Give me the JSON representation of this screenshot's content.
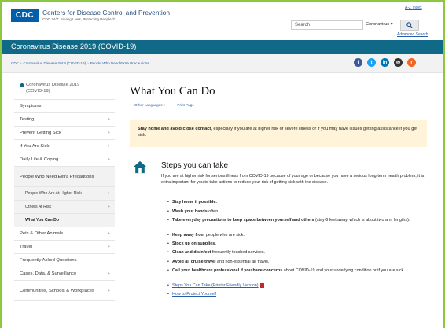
{
  "header": {
    "logo_text": "CDC",
    "brand_name": "Centers for Disease Control and Prevention",
    "brand_tagline": "CDC 24/7: Saving Lives, Protecting People™",
    "az_link": "A-Z Index",
    "search_placeholder": "Search",
    "search_scope": "Coronavirus ▾",
    "advanced_search": "Advanced Search"
  },
  "titlebar": {
    "title": "Coronavirus Disease 2019 (COVID-19)"
  },
  "breadcrumb": [
    "CDC",
    "Coronavirus Disease 2019 (COVID-19)",
    "People Who Need Extra Precautions"
  ],
  "social": [
    {
      "name": "facebook-icon",
      "glyph": "f",
      "color": "#3b5998"
    },
    {
      "name": "twitter-icon",
      "glyph": "t",
      "color": "#1da1f2"
    },
    {
      "name": "linkedin-icon",
      "glyph": "in",
      "color": "#0077b5"
    },
    {
      "name": "email-icon",
      "glyph": "✉",
      "color": "#333333"
    },
    {
      "name": "rss-icon",
      "glyph": "r",
      "color": "#f26522"
    }
  ],
  "sidebar": {
    "items": [
      {
        "label": "Coronavirus Disease 2019 (COVID-19)",
        "home": true
      },
      {
        "label": "Symptoms"
      },
      {
        "label": "Testing",
        "chevron": true
      },
      {
        "label": "Prevent Getting Sick",
        "chevron": true
      },
      {
        "label": "If You Are Sick",
        "chevron": true
      },
      {
        "label": "Daily Life & Coping",
        "chevron": true
      },
      {
        "label": "People Who Need Extra Precautions",
        "selected": true
      },
      {
        "label": "People Who Are At Higher Risk",
        "sub": true,
        "chevron": true
      },
      {
        "label": "Others At Risk",
        "sub": true,
        "chevron": true
      },
      {
        "label": "What You Can Do",
        "sub": true,
        "current": true
      },
      {
        "label": "Pets & Other Animals",
        "chevron": true
      },
      {
        "label": "Travel",
        "chevron": true
      },
      {
        "label": "Frequently Asked Questions"
      },
      {
        "label": "Cases, Data, & Surveillance",
        "chevron": true
      },
      {
        "label": "Communities, Schools & Workplaces",
        "chevron": true
      }
    ]
  },
  "main": {
    "title": "What You Can Do",
    "other_languages": "Other Languages ▾",
    "print_page": "Print Page",
    "alert_bold": "Stay home and avoid close contact,",
    "alert_text": " especially if you are at higher risk of severe illness or if you may have issues getting assistance if you get sick.",
    "steps_heading": "Steps you can take",
    "steps_intro": "If you are at higher risk for serious illness from COVID-19 because of your age or because you have a serious long-term health problem, it is extra important for you to take actions to reduce your risk of getting sick with the disease.",
    "bullets": [
      {
        "bold": "Stay home if possible.",
        "text": ""
      },
      {
        "bold": "Wash your hands",
        "text": " often."
      },
      {
        "bold": "Take everyday precautions to keep space between yourself and others",
        "text": " (stay 6 feet away, which is about two arm lengths)."
      },
      {
        "bold": "Keep away from",
        "text": " people who are sick."
      },
      {
        "bold": "Stock up on supplies.",
        "text": ""
      },
      {
        "bold": "Clean and disinfect",
        "text": " frequently touched services."
      },
      {
        "bold": "Avoid all cruise travel",
        "text": " and non-essential air travel."
      },
      {
        "bold": "Call your healthcare professional if you have concerns",
        "text": " about COVID-19 and your underlying condition or if you are sick."
      }
    ],
    "links": [
      {
        "label": "Steps You Can Take (Printer Friendly Version)",
        "pdf": true
      },
      {
        "label": "How to Protect Yourself",
        "pdf": false
      }
    ]
  }
}
